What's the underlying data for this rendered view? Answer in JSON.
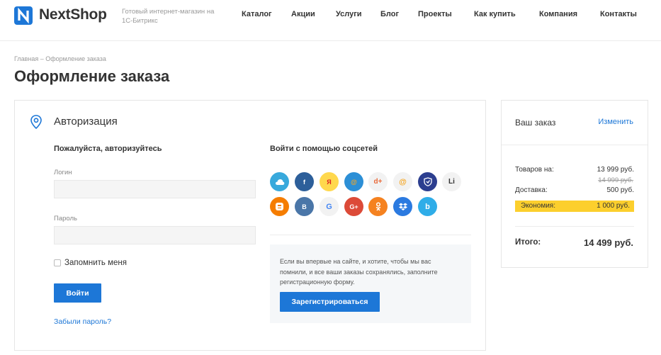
{
  "header": {
    "logo_text": "NextShop",
    "slogan": "Готовый интернет-магазин на 1С-Битрикс",
    "nav": [
      "Каталог",
      "Акции",
      "Услуги",
      "Блог",
      "Проекты",
      "Как купить",
      "Компания",
      "Контакты"
    ],
    "brand_color": "#1d77d7"
  },
  "breadcrumb": "Главная – Оформление заказа",
  "page_title": "Оформление заказа",
  "auth": {
    "section_title": "Авторизация",
    "subtitle": "Пожалуйста, авторизуйтесь",
    "login_label": "Логин",
    "login_value": "",
    "password_label": "Пароль",
    "password_value": "",
    "remember_label": "Запомнить меня",
    "login_button": "Войти",
    "forgot_link": "Забыли пароль?"
  },
  "social": {
    "title": "Войти с помощью соцсетей",
    "buttons": [
      {
        "name": "cloud-icon",
        "label": "",
        "color": "#38a9dc"
      },
      {
        "name": "facebook-icon",
        "label": "f",
        "color": "#2d5f9a"
      },
      {
        "name": "yandex-icon",
        "label": "Я",
        "color": "#ffd84d"
      },
      {
        "name": "mail-ru-icon",
        "label": "@",
        "color": "#2c8fd6"
      },
      {
        "name": "livejournal-icon",
        "label": "d+",
        "color": "#f2f2f2"
      },
      {
        "name": "mail-icon",
        "label": "@",
        "color": "#f2f2f2"
      },
      {
        "name": "shield-icon",
        "label": "",
        "color": "#2c3e8f"
      },
      {
        "name": "liveinternet-icon",
        "label": "Li",
        "color": "#f2f2f2"
      },
      {
        "name": "blogger-icon",
        "label": "B",
        "color": "#f57d00"
      },
      {
        "name": "vk-icon",
        "label": "В",
        "color": "#4a76a8"
      },
      {
        "name": "google-icon",
        "label": "G",
        "color": "#f2f2f2"
      },
      {
        "name": "google-plus-icon",
        "label": "G+",
        "color": "#dc4a38"
      },
      {
        "name": "odnoklassniki-icon",
        "label": "ok",
        "color": "#f58220"
      },
      {
        "name": "dropbox-icon",
        "label": "",
        "color": "#2b7ae0"
      },
      {
        "name": "bitrix24-icon",
        "label": "b",
        "color": "#2fade8"
      }
    ]
  },
  "register": {
    "text": "Если вы впервые на сайте, и хотите, чтобы мы вас помнили, и все ваши заказы сохранялись, заполните регистрационную форму.",
    "button": "Зарегистрироваться"
  },
  "order": {
    "title": "Ваш заказ",
    "change_link": "Изменить",
    "goods_label": "Товаров на:",
    "goods_value": "13 999 руб.",
    "old_price": "14 999 руб.",
    "delivery_label": "Доставка:",
    "delivery_value": "500 руб.",
    "savings_label": "Экономия:",
    "savings_value": "1 000 руб.",
    "savings_color": "#fccf2d",
    "total_label": "Итого:",
    "total_value": "14 499 руб."
  }
}
